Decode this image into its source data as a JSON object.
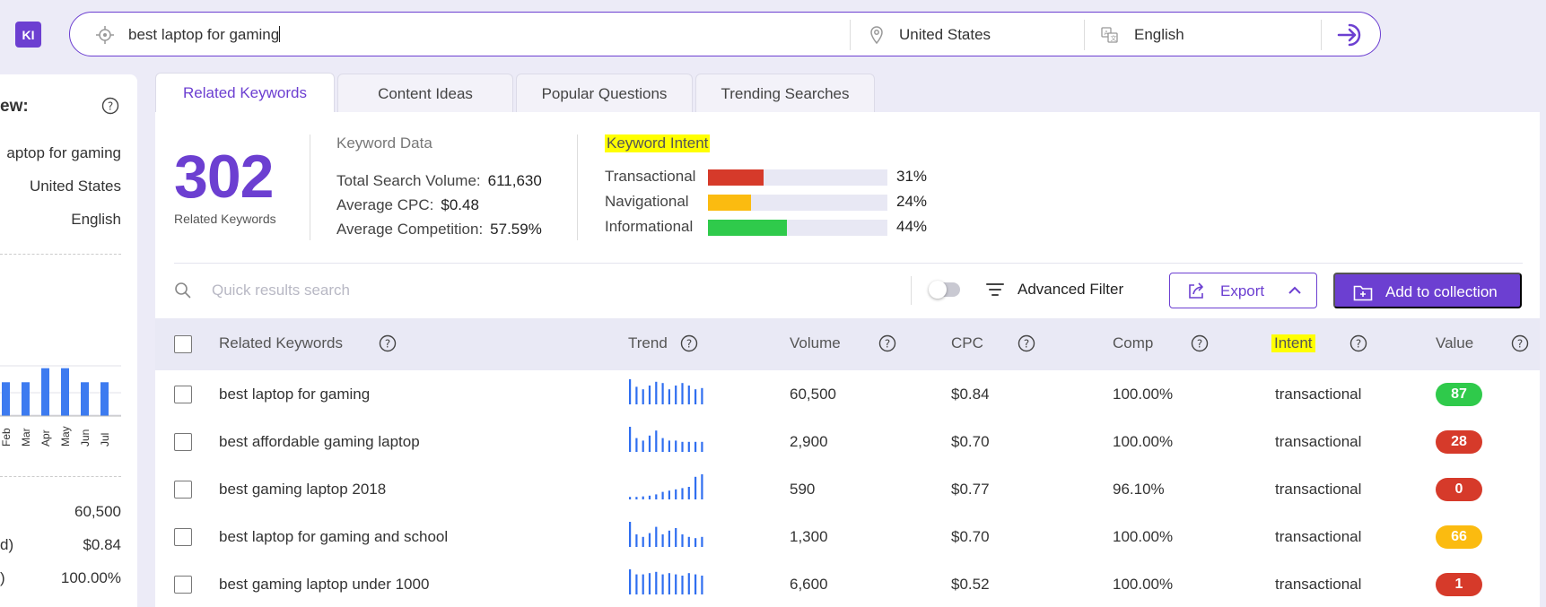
{
  "app": {
    "logo_text": "KI"
  },
  "search": {
    "query": "best laptop for gaming",
    "location": "United States",
    "language": "English",
    "icons": {
      "target": "crosshair-icon",
      "location": "map-pin-icon",
      "language": "translate-icon",
      "submit": "login-arrow-icon"
    }
  },
  "overview": {
    "title": "ew:",
    "keyword": "aptop for gaming",
    "location": "United States",
    "language": "English",
    "month_labels": [
      "Feb",
      "Mar",
      "Apr",
      "May",
      "Jun",
      "Jul"
    ],
    "month_values": [
      0.65,
      0.65,
      0.92,
      0.92,
      0.65,
      0.65
    ],
    "volume": "60,500",
    "cpc_label": "d)",
    "cpc": "$0.84",
    "comp_label": ")",
    "comp": "100.00%"
  },
  "tabs": [
    {
      "label": "Related Keywords",
      "active": true
    },
    {
      "label": "Content Ideas",
      "active": false
    },
    {
      "label": "Popular Questions",
      "active": false
    },
    {
      "label": "Trending Searches",
      "active": false
    }
  ],
  "summary": {
    "count": "302",
    "count_label": "Related Keywords",
    "keyword_data_title": "Keyword Data",
    "total_volume_label": "Total Search Volume:",
    "total_volume": "611,630",
    "avg_cpc_label": "Average CPC:",
    "avg_cpc": "$0.48",
    "avg_comp_label": "Average Competition:",
    "avg_comp": "57.59%"
  },
  "intent": {
    "title": "Keyword Intent",
    "rows": [
      {
        "label": "Transactional",
        "pct": "31%",
        "fraction": 0.31,
        "color": "#d63a2a"
      },
      {
        "label": "Navigational",
        "pct": "24%",
        "fraction": 0.24,
        "color": "#fbbb10"
      },
      {
        "label": "Informational",
        "pct": "44%",
        "fraction": 0.44,
        "color": "#2fca4b"
      }
    ]
  },
  "toolbar": {
    "search_placeholder": "Quick results search",
    "advanced_filter": "Advanced Filter",
    "export": "Export",
    "add_to_collection": "Add to collection"
  },
  "table": {
    "headers": {
      "keyword": "Related Keywords",
      "trend": "Trend",
      "volume": "Volume",
      "cpc": "CPC",
      "comp": "Comp",
      "intent": "Intent",
      "value": "Value"
    },
    "rows": [
      {
        "keyword": "best laptop for gaming",
        "volume": "60,500",
        "cpc": "$0.84",
        "comp": "100.00%",
        "intent": "transactional",
        "value": "87",
        "value_color": "#2fca4b",
        "trend": [
          1.0,
          0.7,
          0.6,
          0.75,
          0.9,
          0.85,
          0.6,
          0.75,
          0.85,
          0.75,
          0.6,
          0.65
        ]
      },
      {
        "keyword": "best affordable gaming laptop",
        "volume": "2,900",
        "cpc": "$0.70",
        "comp": "100.00%",
        "intent": "transactional",
        "value": "28",
        "value_color": "#d63a2a",
        "trend": [
          1.0,
          0.55,
          0.45,
          0.65,
          0.85,
          0.55,
          0.45,
          0.45,
          0.4,
          0.4,
          0.4,
          0.4
        ]
      },
      {
        "keyword": "best gaming laptop 2018",
        "volume": "590",
        "cpc": "$0.77",
        "comp": "96.10%",
        "intent": "transactional",
        "value": "0",
        "value_color": "#d63a2a",
        "trend": [
          0.1,
          0.1,
          0.12,
          0.15,
          0.2,
          0.3,
          0.35,
          0.4,
          0.45,
          0.5,
          0.9,
          1.0
        ]
      },
      {
        "keyword": "best laptop for gaming and school",
        "volume": "1,300",
        "cpc": "$0.70",
        "comp": "100.00%",
        "intent": "transactional",
        "value": "66",
        "value_color": "#fbbb10",
        "trend": [
          1.0,
          0.5,
          0.4,
          0.55,
          0.8,
          0.5,
          0.65,
          0.75,
          0.5,
          0.4,
          0.35,
          0.4
        ]
      },
      {
        "keyword": "best gaming laptop under 1000",
        "volume": "6,600",
        "cpc": "$0.52",
        "comp": "100.00%",
        "intent": "transactional",
        "value": "1",
        "value_color": "#d63a2a",
        "trend": [
          1.0,
          0.8,
          0.8,
          0.85,
          0.9,
          0.8,
          0.85,
          0.8,
          0.75,
          0.85,
          0.8,
          0.75
        ]
      }
    ]
  }
}
